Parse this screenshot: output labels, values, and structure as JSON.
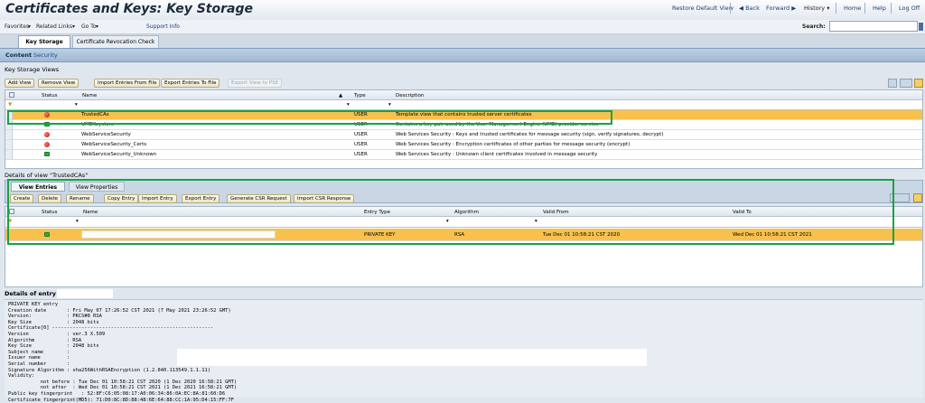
{
  "header": {
    "title": "Certificates and Keys: Key Storage",
    "restore": "Restore Default View",
    "back": "◀ Back",
    "forward": "Forward ▶",
    "history": "History ▾",
    "home": "Home",
    "help": "Help",
    "logoff": "Log Off",
    "search_label": "Search:"
  },
  "menu": {
    "favorites": "Favorites",
    "related": "Related Links",
    "goto": "Go To",
    "support": "Support Info"
  },
  "tabs": [
    "Key Storage",
    "Certificate Revocation Check"
  ],
  "content": {
    "label": "Content",
    "value": "Security"
  },
  "views": {
    "section_title": "Key Storage Views",
    "buttons": [
      "Add View",
      "Remove View",
      "Import Entries From File",
      "Export Entries To File",
      "Export View to PSE"
    ],
    "columns": [
      "Status",
      "Name",
      "Type",
      "Description"
    ],
    "rows": [
      {
        "status": "red",
        "name": "TrustedCAs",
        "type": "USER",
        "description": "Template view that contains trusted server certificates"
      },
      {
        "status": "green",
        "name": "UMEKeystore",
        "type": "USER",
        "description": "Contains a key-pair used by the User Management Engine (UME) provider service"
      },
      {
        "status": "red",
        "name": "WebServiceSecurity",
        "type": "USER",
        "description": "Web Services Security : Keys and trusted certificates for message security (sign, verify signatures, decrypt)"
      },
      {
        "status": "red",
        "name": "WebServiceSecurity_Certs",
        "type": "USER",
        "description": "Web Services Security : Encryption certificates of other parties for message security (encrypt)"
      },
      {
        "status": "green",
        "name": "WebServiceSecurity_Unknown",
        "type": "USER",
        "description": "Web Services Security : Unknown client certificates involved in message security"
      }
    ]
  },
  "details": {
    "title": "Details of view \"TrustedCAs\"",
    "tabs": [
      "View Entries",
      "View Properties"
    ],
    "buttons": [
      "Create",
      "Delete",
      "Rename",
      "Copy Entry",
      "Import Entry",
      "Export Entry",
      "Generate CSR Request",
      "Import CSR Response"
    ],
    "columns": [
      "Status",
      "Name",
      "Entry Type",
      "Algorithm",
      "Valid From",
      "Valid To"
    ],
    "row": {
      "entry_type": "PRIVATE KEY",
      "algorithm": "RSA",
      "valid_from": "Tue Dec 01 10:58:21 CST 2020",
      "valid_to": "Wed Dec 01 10:58:21 CST 2021"
    }
  },
  "entry": {
    "title": "Details of entry",
    "lines": [
      "PRIVATE KEY entry",
      "Creation date       : Fri May 07 17:26:52 CST 2021 (7 May 2021 23:26:52 GMT)",
      "Version:            : PKCS#8 RSA",
      "Key Size            : 2048 bits",
      "Certificate[0] -------------------------------------------------------",
      "Version             : ver.3 X.509",
      "Algorithm           : RSA",
      "Key Size            : 2048 bits",
      "Subject name        :",
      "Issuer name         :",
      "Serial number       :",
      "Signature Algorithm : sha256WithRSAEncryption (1.2.840.113549.1.1.11)",
      "Validity:",
      "           not before : Tue Dec 01 10:58:21 CST 2020 (1 Dec 2020 16:58:21 GMT)",
      "           not after  : Wed Dec 01 10:58:21 CST 2021 (1 Dec 2021 16:58:21 GMT)",
      "Public key fingerprint   : 52:8F:C6:05:08:17:A0:06:34:86:0A:EC:8A:81:60:D6",
      "Certificate fingerprint(MD5): 71:D0:8C:8D:88:48:6E:64:88:CC:1A:95:D4:15:FF:7F"
    ]
  },
  "colors": {
    "selected_row": "#f8c14d",
    "highlight_box": "#18a246",
    "status_red": "#b11a0b",
    "status_green": "#22b43b"
  }
}
